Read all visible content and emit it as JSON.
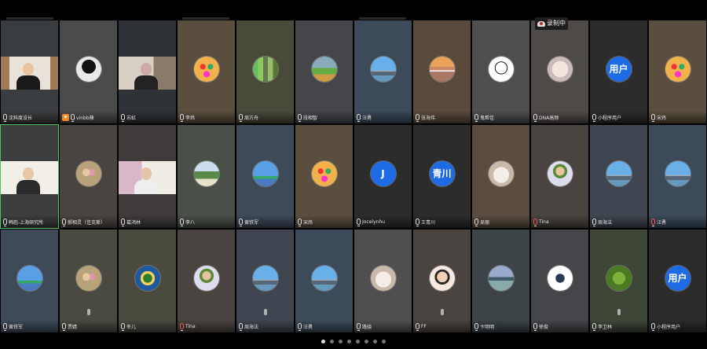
{
  "recording": {
    "label": "录制中"
  },
  "pagination": {
    "pages": 8,
    "current": 0
  },
  "participants": [
    {
      "name": "沈科度设长",
      "bg": "#3a3d40",
      "type": "video",
      "video": "room",
      "mic": "on"
    },
    {
      "name": "vinbb辣",
      "bg": "#4a4a4a",
      "type": "avatar",
      "avatar": "a-dark",
      "host": true,
      "mic": "on"
    },
    {
      "name": "苏虹",
      "bg": "#2f3236",
      "type": "video",
      "video": "home",
      "mic": "on"
    },
    {
      "name": "李炜",
      "bg": "#5a4e3e",
      "type": "avatar",
      "avatar": "a-cartoon",
      "mic": "on"
    },
    {
      "name": "周方舟",
      "bg": "#4a4a3a",
      "type": "avatar",
      "avatar": "a-forest",
      "mic": "on"
    },
    {
      "name": "段相智",
      "bg": "#45464a",
      "type": "avatar",
      "avatar": "a-field",
      "mic": "on"
    },
    {
      "name": "汪勇",
      "bg": "#3c4a5a",
      "type": "avatar",
      "avatar": "a-city",
      "mic": "on"
    },
    {
      "name": "张海伟",
      "bg": "#5a4a3c",
      "type": "avatar",
      "avatar": "a-sunset",
      "mic": "on"
    },
    {
      "name": "鬼帮佳",
      "bg": "#4f4f4f",
      "type": "avatar",
      "avatar": "a-sketch",
      "mic": "on"
    },
    {
      "name": "DNA高频",
      "bg": "#4e4a48",
      "type": "avatar",
      "avatar": "a-dog",
      "mic": "on"
    },
    {
      "name": "小程序用户",
      "bg": "#2c2c2c",
      "type": "letter",
      "letter": "用户",
      "mic": "on"
    },
    {
      "name": "宋炜",
      "bg": "#5a4e3e",
      "type": "avatar",
      "avatar": "a-cartoon",
      "mic": "on"
    },
    {
      "name": "韩彪-上海研究所",
      "bg": "#3b3d3e",
      "type": "video",
      "video": "office",
      "mic": "on",
      "active": true
    },
    {
      "name": "郝相灵（佳克斯）",
      "bg": "#4a4440",
      "type": "avatar",
      "avatar": "a-kids",
      "mic": "on"
    },
    {
      "name": "葛鸿林",
      "bg": "#3e3b3a",
      "type": "video",
      "video": "elder",
      "mic": "on"
    },
    {
      "name": "李八",
      "bg": "#4a5048",
      "type": "avatar",
      "avatar": "a-garden",
      "mic": "on"
    },
    {
      "name": "黄铁军",
      "bg": "#3e4a58",
      "type": "avatar",
      "avatar": "a-sky",
      "mic": "on"
    },
    {
      "name": "宋炜",
      "bg": "#5a4e3e",
      "type": "avatar",
      "avatar": "a-cartoon",
      "mic": "on"
    },
    {
      "name": "Jocelynhu",
      "bg": "#2c2c2c",
      "type": "letter",
      "letter": "J",
      "mic": "on"
    },
    {
      "name": "王青川",
      "bg": "#2c2c2c",
      "type": "letter",
      "letter": "青川",
      "mic": "on"
    },
    {
      "name": "吴丽",
      "bg": "#5a4c40",
      "type": "avatar",
      "avatar": "a-cat",
      "mic": "on"
    },
    {
      "name": "Tina",
      "bg": "#4a4440",
      "type": "avatar",
      "avatar": "a-portrait",
      "mic": "off"
    },
    {
      "name": "周海法",
      "bg": "#404650",
      "type": "avatar",
      "avatar": "a-city",
      "mic": "on"
    },
    {
      "name": "汪勇",
      "bg": "#3c4a5a",
      "type": "avatar",
      "avatar": "a-city",
      "mic": "off"
    },
    {
      "name": "黄铁军",
      "bg": "#3e4a58",
      "type": "avatar",
      "avatar": "a-sky",
      "mic": "on"
    },
    {
      "name": "贾婧",
      "bg": "#4a4a40",
      "type": "avatar",
      "avatar": "a-kids",
      "mic": "on",
      "speaking": true
    },
    {
      "name": "冬儿",
      "bg": "#4a4a3e",
      "type": "avatar",
      "avatar": "a-badge",
      "mic": "on"
    },
    {
      "name": "Tina",
      "bg": "#4a4440",
      "type": "avatar",
      "avatar": "a-portrait",
      "mic": "off"
    },
    {
      "name": "周海法",
      "bg": "#404650",
      "type": "avatar",
      "avatar": "a-city",
      "mic": "on",
      "speaking": true
    },
    {
      "name": "汪勇",
      "bg": "#3c4a5a",
      "type": "avatar",
      "avatar": "a-city",
      "mic": "on"
    },
    {
      "name": "路骁",
      "bg": "#4f4f4f",
      "type": "avatar",
      "avatar": "a-cat",
      "mic": "on"
    },
    {
      "name": "FF",
      "bg": "#4a4440",
      "type": "avatar",
      "avatar": "a-child",
      "mic": "on",
      "speaking": true
    },
    {
      "name": "卞明明",
      "bg": "#3c4448",
      "type": "avatar",
      "avatar": "a-lake",
      "mic": "on"
    },
    {
      "name": "徐俊",
      "bg": "#44464a",
      "type": "avatar",
      "avatar": "a-bear",
      "mic": "on"
    },
    {
      "name": "李卫林",
      "bg": "#3e4638",
      "type": "avatar",
      "avatar": "a-leaf",
      "mic": "on",
      "speaking": true
    },
    {
      "name": "小程序用户",
      "bg": "#2c2c2c",
      "type": "letter",
      "letter": "用户",
      "mic": "on"
    }
  ]
}
